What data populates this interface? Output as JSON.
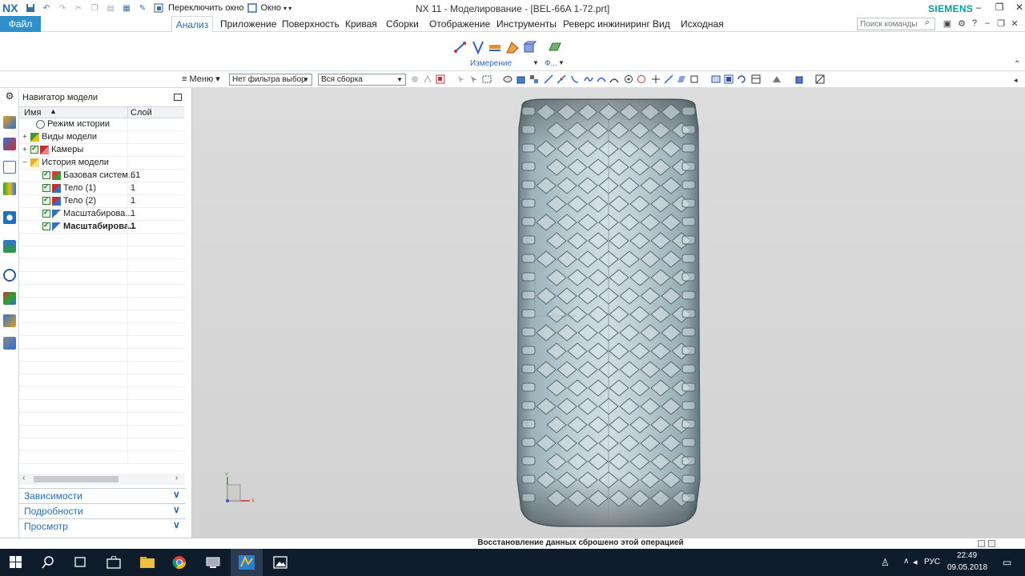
{
  "app": {
    "logo": "NX",
    "title": "NX 11 - Моделирование - [BEL-66A 1-72.prt]",
    "brand": "SIEMENS",
    "accent_color": "#2e8fc9"
  },
  "quick_access": {
    "switch_window": "Переключить окно",
    "window_menu": "Окно"
  },
  "ribbon": {
    "file_tab": "Файл",
    "tabs": [
      "Анализ",
      "Приложение",
      "Поверхность",
      "Кривая",
      "Сборки",
      "Отображение",
      "Инструменты",
      "Реверс инжиниринг",
      "Вид",
      "Исходная"
    ],
    "active_tab": "Анализ",
    "command_search_placeholder": "Поиск команды",
    "groups": {
      "measure": "Измерение",
      "f": "Ф..."
    }
  },
  "selection_bar": {
    "menu_label": "Меню",
    "type_filter": "Нет фильтра выбор",
    "scope": "Вся сборка"
  },
  "navigator": {
    "title": "Навигатор модели",
    "columns": {
      "name": "Имя",
      "layer": "Слой"
    },
    "rows": [
      {
        "label": "Режим истории",
        "layer": "",
        "indent": 1,
        "icon": "clock-icon",
        "expand": "",
        "check": false,
        "bold": false
      },
      {
        "label": "Виды модели",
        "layer": "",
        "indent": 0,
        "icon": "views-icon",
        "expand": "+",
        "check": false,
        "bold": false
      },
      {
        "label": "Камеры",
        "layer": "",
        "indent": 0,
        "icon": "camera-icon",
        "expand": "+",
        "check": true,
        "bold": false
      },
      {
        "label": "История модели",
        "layer": "",
        "indent": 0,
        "icon": "folder-icon",
        "expand": "−",
        "check": false,
        "bold": false
      },
      {
        "label": "Базовая систем...",
        "layer": "61",
        "indent": 2,
        "icon": "csys-icon",
        "expand": "",
        "check": true,
        "bold": false
      },
      {
        "label": "Тело (1)",
        "layer": "1",
        "indent": 2,
        "icon": "body-icon",
        "expand": "",
        "check": true,
        "bold": false
      },
      {
        "label": "Тело (2)",
        "layer": "1",
        "indent": 2,
        "icon": "body-icon",
        "expand": "",
        "check": true,
        "bold": false
      },
      {
        "label": "Масштабирова...",
        "layer": "1",
        "indent": 2,
        "icon": "scale-icon",
        "expand": "",
        "check": true,
        "bold": false
      },
      {
        "label": "Масштабирова...",
        "layer": "1",
        "indent": 2,
        "icon": "scale-icon",
        "expand": "",
        "check": true,
        "bold": true
      }
    ],
    "panels": [
      "Зависимости",
      "Подробности",
      "Просмотр"
    ]
  },
  "status": {
    "message": "Восстановление данных сброшено этой операцией"
  },
  "taskbar": {
    "language": "РУС",
    "time": "22:49",
    "date": "09.05.2018"
  }
}
